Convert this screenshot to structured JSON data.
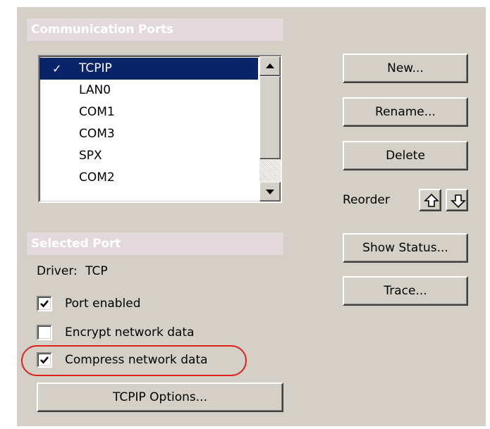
{
  "communication_ports": {
    "header": "Communication Ports",
    "items": [
      {
        "label": "TCPIP",
        "selected": true,
        "checked": true
      },
      {
        "label": "LAN0",
        "selected": false,
        "checked": false
      },
      {
        "label": "COM1",
        "selected": false,
        "checked": false
      },
      {
        "label": "COM3",
        "selected": false,
        "checked": false
      },
      {
        "label": "SPX",
        "selected": false,
        "checked": false
      },
      {
        "label": "COM2",
        "selected": false,
        "checked": false
      }
    ],
    "check_glyph": "✓"
  },
  "buttons": {
    "new": "New...",
    "rename": "Rename...",
    "delete": "Delete",
    "reorder_label": "Reorder",
    "show_status": "Show Status...",
    "trace": "Trace...",
    "tcpip_options": "TCPIP Options..."
  },
  "selected_port": {
    "header": "Selected Port",
    "driver_label": "Driver:",
    "driver_value": "TCP",
    "port_enabled": {
      "label": "Port enabled",
      "checked": true
    },
    "encrypt_network_data": {
      "label": "Encrypt network data",
      "checked": false
    },
    "compress_network_data": {
      "label": "Compress network data",
      "checked": true
    }
  },
  "icons": {
    "reorder_up": "up-arrow-icon",
    "reorder_down": "down-arrow-icon",
    "scroll_up": "scroll-up-icon",
    "scroll_down": "scroll-down-icon"
  },
  "colors": {
    "panel": "#d4d0c8",
    "section_header": "#e3d9dc",
    "selection": "#0a246a",
    "annotation_ring": "#e0201c"
  }
}
